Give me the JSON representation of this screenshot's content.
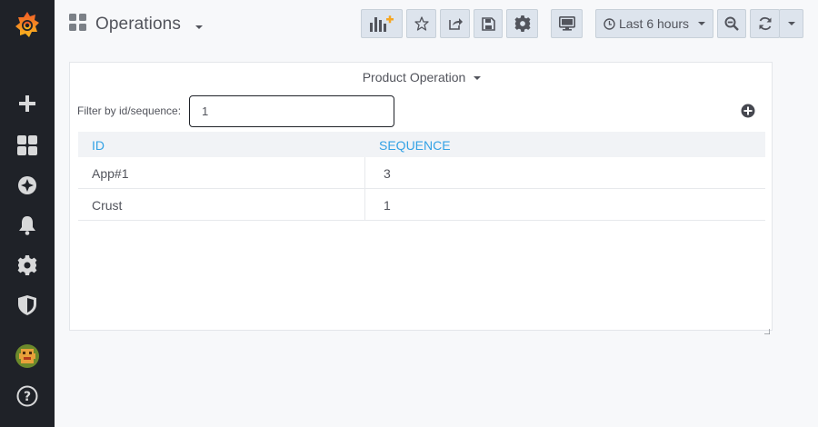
{
  "sidebar": {
    "icons": [
      "grafana-logo-icon",
      "plus-icon",
      "dashboards-icon",
      "explore-compass-icon",
      "alerting-bell-icon",
      "configuration-gear-icon",
      "server-admin-shield-icon",
      "user-avatar-icon",
      "help-icon"
    ]
  },
  "header": {
    "dashboard_title": "Operations",
    "time_range_label": "Last 6 hours"
  },
  "panel": {
    "title": "Product Operation",
    "filter_label": "Filter by id/sequence:",
    "filter_value": "1",
    "filter_placeholder": "",
    "columns": [
      "ID",
      "SEQUENCE"
    ],
    "rows": [
      {
        "id": "App#1",
        "sequence": "3"
      },
      {
        "id": "Crust",
        "sequence": "1"
      }
    ]
  },
  "colors": {
    "sidebar_bg": "#1f2228",
    "accent_blue": "#33a2e5",
    "logo_orange": "#f05a28"
  }
}
